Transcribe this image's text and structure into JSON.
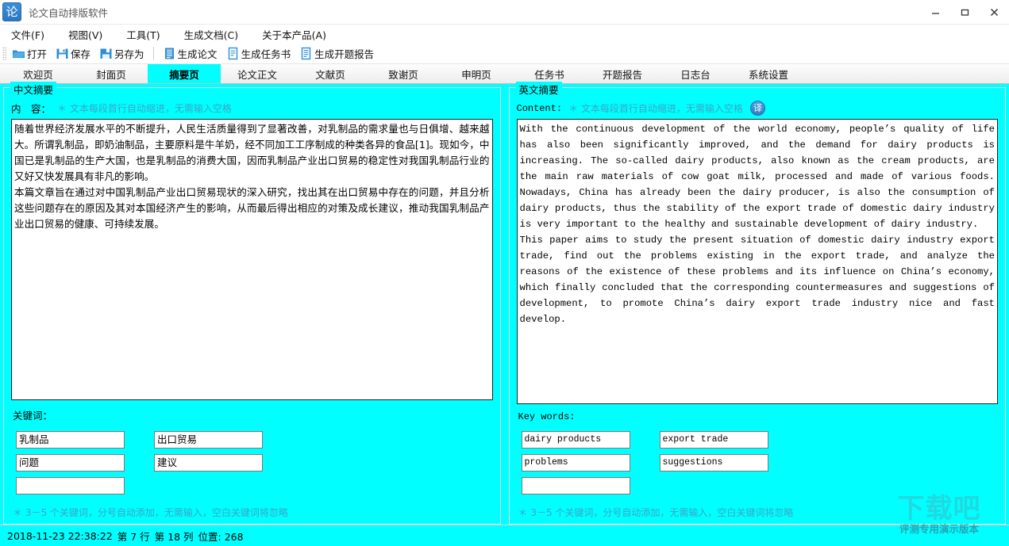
{
  "window": {
    "app_icon_glyph": "论",
    "title": "论文自动排版软件",
    "minimize_label": "–",
    "maximize_label": "□",
    "close_label": "✕"
  },
  "menubar": {
    "items": [
      {
        "label": "文件(F)"
      },
      {
        "label": "视图(V)"
      },
      {
        "label": "工具(T)"
      },
      {
        "label": "生成文档(C)"
      },
      {
        "label": "关于本产品(A)"
      }
    ]
  },
  "toolbar": {
    "items": [
      {
        "label": "打开",
        "icon": "folder-open-icon",
        "color": "#2f8fd4"
      },
      {
        "label": "保存",
        "icon": "save-icon",
        "color": "#2f8fd4"
      },
      {
        "label": "另存为",
        "icon": "save-as-icon",
        "color": "#2f8fd4"
      },
      {
        "label": "生成论文",
        "icon": "document-lines-icon",
        "color": "#2f8fd4"
      },
      {
        "label": "生成任务书",
        "icon": "document-icon",
        "color": "#2f8fd4"
      },
      {
        "label": "生成开题报告",
        "icon": "document-report-icon",
        "color": "#2f8fd4"
      }
    ]
  },
  "tabs": {
    "active_index": 2,
    "items": [
      {
        "label": "欢迎页"
      },
      {
        "label": "封面页"
      },
      {
        "label": "摘要页"
      },
      {
        "label": "论文正文"
      },
      {
        "label": "文献页"
      },
      {
        "label": "致谢页"
      },
      {
        "label": "申明页"
      },
      {
        "label": "任务书"
      },
      {
        "label": "开题报告"
      },
      {
        "label": "日志台"
      },
      {
        "label": "系统设置"
      }
    ]
  },
  "cn_panel": {
    "legend": "中文摘要",
    "content_label": "内　容：",
    "content_hint": "＊ 文本每段首行自动缩进，无需输入空格",
    "paragraphs": [
      "随着世界经济发展水平的不断提升，人民生活质量得到了显著改善，对乳制品的需求量也与日俱增、越来越大。所谓乳制品，即奶油制品，主要原料是牛羊奶，经不同加工工序制成的种类各异的食品[1]。现如今，中国已是乳制品的生产大国，也是乳制品的消费大国，因而乳制品产业出口贸易的稳定性对我国乳制品行业的又好又快发展具有非凡的影响。",
      "本篇文章旨在通过对中国乳制品产业出口贸易现状的深入研究，找出其在出口贸易中存在的问题，并且分析这些问题存在的原因及其对本国经济产生的影响，从而最后得出相应的对策及成长建议，推动我国乳制品产业出口贸易的健康、可持续发展。"
    ],
    "keywords_label": "关键词：",
    "keywords": [
      "乳制品",
      "出口贸易",
      "问题",
      "建议",
      ""
    ],
    "keywords_hint": "＊ 3－5 个关键词，分号自动添加，无需输入，空白关键词将忽略"
  },
  "en_panel": {
    "legend": "英文摘要",
    "content_label": "Content:",
    "content_hint": "＊ 文本每段首行自动缩进，无需输入空格",
    "translate_button": "译",
    "paragraphs": [
      "With the continuous development of the world economy, people’s quality of life has also been significantly improved, and the demand for dairy products is increasing. The so-called dairy products, also known as the cream products, are the main raw materials of cow goat milk, processed and made of various foods. Nowadays, China has already been the dairy producer, is also the consumption of dairy products, thus the stability of the export trade of domestic dairy industry is very important to the healthy and sustainable development of dairy industry.",
      "This paper aims to study the present situation of domestic dairy industry export trade, find out the problems existing in the export trade, and analyze the reasons of the existence of these problems and its influence on China’s economy, which finally concluded that the corresponding countermeasures and suggestions of development, to promote China’s dairy export trade industry nice and fast develop."
    ],
    "keywords_label": "Key words:",
    "keywords": [
      "dairy products",
      "export trade",
      "problems",
      "suggestions",
      ""
    ],
    "keywords_hint": "＊ 3－5 个关键词，分号自动添加，无需输入，空白关键词将忽略"
  },
  "statusbar": {
    "datetime": "2018-11-23 22:38:22",
    "line": "第 7 行",
    "column": "第 18 列",
    "position": "位置: 268"
  },
  "watermark": {
    "big": "下载吧",
    "small": "评测专用演示版本"
  },
  "colors": {
    "page_bg": "#00FFFF",
    "accent": "#2f8fd4",
    "hint": "#3aa6c8",
    "active_tab": "#00FFFF"
  }
}
